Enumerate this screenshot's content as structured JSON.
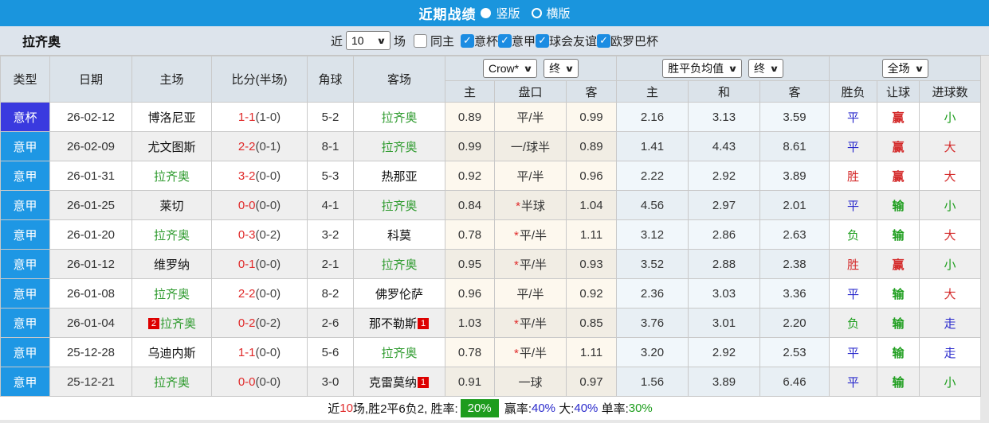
{
  "title_bar": {
    "title": "近期战绩",
    "radio_vertical_label": "竖版",
    "radio_horizontal_label": "横版",
    "vertical_selected": true
  },
  "filter_bar": {
    "team": "拉齐奥",
    "recent_label": "近",
    "recent_value": "10",
    "games_label": "场",
    "same_home_label": "同主",
    "same_home_checked": false,
    "competitions": [
      {
        "label": "意杯",
        "checked": true
      },
      {
        "label": "意甲",
        "checked": true
      },
      {
        "label": "球会友谊",
        "checked": true
      },
      {
        "label": "欧罗巴杯",
        "checked": true
      }
    ]
  },
  "colors": {
    "accent_blue": "#1a95dd",
    "cup_badge": "#3a3adf",
    "league_badge": "#1e97e4",
    "win_red": "#d42a2a",
    "lose_green": "#1e9e1e",
    "draw_blue": "#2a2acc"
  },
  "table": {
    "headers": [
      "类型",
      "日期",
      "主场",
      "比分(半场)",
      "角球",
      "客场"
    ],
    "selects": {
      "company": "Crow*",
      "time1": "终",
      "avg": "胜平负均值",
      "time2": "终",
      "period": "全场"
    },
    "sub_headers": [
      "主",
      "盘口",
      "客",
      "主",
      "和",
      "客",
      "胜负",
      "让球",
      "进球数"
    ],
    "rows": [
      {
        "type": "意杯",
        "type_style": "cup",
        "date": "26-02-12",
        "home": "博洛尼亚",
        "home_green": false,
        "home_card": "",
        "score": "1-1",
        "half": "(1-0)",
        "corner": "5-2",
        "away": "拉齐奥",
        "away_green": true,
        "away_card": "",
        "crow_home": "0.89",
        "handicap": "平/半",
        "handicap_star": false,
        "crow_away": "0.99",
        "avg_home": "2.16",
        "avg_draw": "3.13",
        "avg_away": "3.59",
        "result": "平",
        "result_color": "blue",
        "handicap_result": "赢",
        "handicap_result_color": "red",
        "goals": "小",
        "goals_color": "green"
      },
      {
        "type": "意甲",
        "type_style": "league",
        "date": "26-02-09",
        "home": "尤文图斯",
        "home_green": false,
        "home_card": "",
        "score": "2-2",
        "half": "(0-1)",
        "corner": "8-1",
        "away": "拉齐奥",
        "away_green": true,
        "away_card": "",
        "crow_home": "0.99",
        "handicap": "一/球半",
        "handicap_star": false,
        "crow_away": "0.89",
        "avg_home": "1.41",
        "avg_draw": "4.43",
        "avg_away": "8.61",
        "result": "平",
        "result_color": "blue",
        "handicap_result": "赢",
        "handicap_result_color": "red",
        "goals": "大",
        "goals_color": "red"
      },
      {
        "type": "意甲",
        "type_style": "league",
        "date": "26-01-31",
        "home": "拉齐奥",
        "home_green": true,
        "home_card": "",
        "score": "3-2",
        "half": "(0-0)",
        "corner": "5-3",
        "away": "热那亚",
        "away_green": false,
        "away_card": "",
        "crow_home": "0.92",
        "handicap": "平/半",
        "handicap_star": false,
        "crow_away": "0.96",
        "avg_home": "2.22",
        "avg_draw": "2.92",
        "avg_away": "3.89",
        "result": "胜",
        "result_color": "red",
        "handicap_result": "赢",
        "handicap_result_color": "red",
        "goals": "大",
        "goals_color": "red"
      },
      {
        "type": "意甲",
        "type_style": "league",
        "date": "26-01-25",
        "home": "莱切",
        "home_green": false,
        "home_card": "",
        "score": "0-0",
        "half": "(0-0)",
        "corner": "4-1",
        "away": "拉齐奥",
        "away_green": true,
        "away_card": "",
        "crow_home": "0.84",
        "handicap": "半球",
        "handicap_star": true,
        "crow_away": "1.04",
        "avg_home": "4.56",
        "avg_draw": "2.97",
        "avg_away": "2.01",
        "result": "平",
        "result_color": "blue",
        "handicap_result": "输",
        "handicap_result_color": "green",
        "goals": "小",
        "goals_color": "green"
      },
      {
        "type": "意甲",
        "type_style": "league",
        "date": "26-01-20",
        "home": "拉齐奥",
        "home_green": true,
        "home_card": "",
        "score": "0-3",
        "half": "(0-2)",
        "corner": "3-2",
        "away": "科莫",
        "away_green": false,
        "away_card": "",
        "crow_home": "0.78",
        "handicap": "平/半",
        "handicap_star": true,
        "crow_away": "1.11",
        "avg_home": "3.12",
        "avg_draw": "2.86",
        "avg_away": "2.63",
        "result": "负",
        "result_color": "green",
        "handicap_result": "输",
        "handicap_result_color": "green",
        "goals": "大",
        "goals_color": "red"
      },
      {
        "type": "意甲",
        "type_style": "league",
        "date": "26-01-12",
        "home": "维罗纳",
        "home_green": false,
        "home_card": "",
        "score": "0-1",
        "half": "(0-0)",
        "corner": "2-1",
        "away": "拉齐奥",
        "away_green": true,
        "away_card": "",
        "crow_home": "0.95",
        "handicap": "平/半",
        "handicap_star": true,
        "crow_away": "0.93",
        "avg_home": "3.52",
        "avg_draw": "2.88",
        "avg_away": "2.38",
        "result": "胜",
        "result_color": "red",
        "handicap_result": "赢",
        "handicap_result_color": "red",
        "goals": "小",
        "goals_color": "green"
      },
      {
        "type": "意甲",
        "type_style": "league",
        "date": "26-01-08",
        "home": "拉齐奥",
        "home_green": true,
        "home_card": "",
        "score": "2-2",
        "half": "(0-0)",
        "corner": "8-2",
        "away": "佛罗伦萨",
        "away_green": false,
        "away_card": "",
        "crow_home": "0.96",
        "handicap": "平/半",
        "handicap_star": false,
        "crow_away": "0.92",
        "avg_home": "2.36",
        "avg_draw": "3.03",
        "avg_away": "3.36",
        "result": "平",
        "result_color": "blue",
        "handicap_result": "输",
        "handicap_result_color": "green",
        "goals": "大",
        "goals_color": "red"
      },
      {
        "type": "意甲",
        "type_style": "league",
        "date": "26-01-04",
        "home": "拉齐奥",
        "home_green": true,
        "home_card": "2",
        "score": "0-2",
        "half": "(0-2)",
        "corner": "2-6",
        "away": "那不勒斯",
        "away_green": false,
        "away_card": "1",
        "crow_home": "1.03",
        "handicap": "平/半",
        "handicap_star": true,
        "crow_away": "0.85",
        "avg_home": "3.76",
        "avg_draw": "3.01",
        "avg_away": "2.20",
        "result": "负",
        "result_color": "green",
        "handicap_result": "输",
        "handicap_result_color": "green",
        "goals": "走",
        "goals_color": "blue"
      },
      {
        "type": "意甲",
        "type_style": "league",
        "date": "25-12-28",
        "home": "乌迪内斯",
        "home_green": false,
        "home_card": "",
        "score": "1-1",
        "half": "(0-0)",
        "corner": "5-6",
        "away": "拉齐奥",
        "away_green": true,
        "away_card": "",
        "crow_home": "0.78",
        "handicap": "平/半",
        "handicap_star": true,
        "crow_away": "1.11",
        "avg_home": "3.20",
        "avg_draw": "2.92",
        "avg_away": "2.53",
        "result": "平",
        "result_color": "blue",
        "handicap_result": "输",
        "handicap_result_color": "green",
        "goals": "走",
        "goals_color": "blue"
      },
      {
        "type": "意甲",
        "type_style": "league",
        "date": "25-12-21",
        "home": "拉齐奥",
        "home_green": true,
        "home_card": "",
        "score": "0-0",
        "half": "(0-0)",
        "corner": "3-0",
        "away": "克雷莫纳",
        "away_green": false,
        "away_card": "1",
        "crow_home": "0.91",
        "handicap": "一球",
        "handicap_star": false,
        "crow_away": "0.97",
        "avg_home": "1.56",
        "avg_draw": "3.89",
        "avg_away": "6.46",
        "result": "平",
        "result_color": "blue",
        "handicap_result": "输",
        "handicap_result_color": "green",
        "goals": "小",
        "goals_color": "green"
      }
    ]
  },
  "footer": {
    "segments": [
      {
        "text": "近",
        "style": "plain"
      },
      {
        "text": "10",
        "style": "red"
      },
      {
        "text": "场,胜2平6负2, 胜率:",
        "style": "plain"
      },
      {
        "text": "20%",
        "style": "badge-green"
      },
      {
        "text": " 赢率:",
        "style": "plain"
      },
      {
        "text": "40%",
        "style": "blue"
      },
      {
        "text": " 大:",
        "style": "plain"
      },
      {
        "text": "40%",
        "style": "blue"
      },
      {
        "text": " 单率:",
        "style": "plain"
      },
      {
        "text": "30%",
        "style": "green"
      }
    ]
  }
}
